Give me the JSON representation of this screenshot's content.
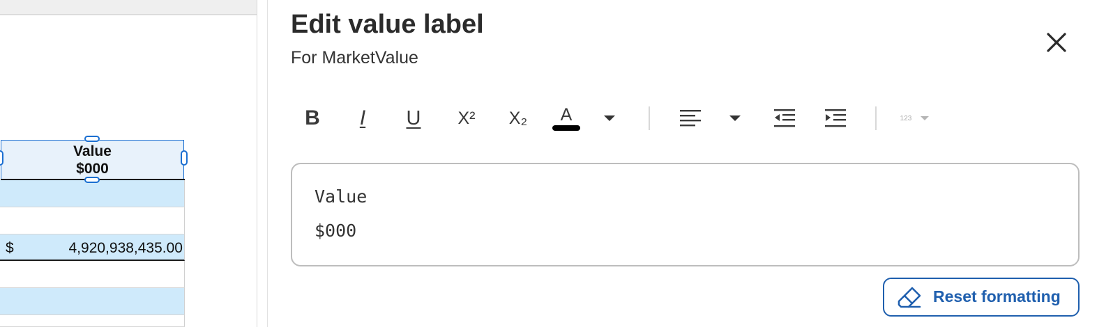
{
  "spreadsheet": {
    "header": {
      "line1": "Value",
      "line2": "$000"
    },
    "row_value": {
      "currency": "$",
      "amount": "4,920,938,435.00"
    }
  },
  "dialog": {
    "title": "Edit value label",
    "subtitle": "For MarketValue",
    "toolbar": {
      "bold": "B",
      "italic": "I",
      "underline": "U",
      "superscript": "X²",
      "subscript": "X₂",
      "text_color": "A",
      "text_color_swatch": "#000000",
      "number_format": "123"
    },
    "editor": {
      "line1": "Value",
      "line2": "$000"
    },
    "reset_button": "Reset formatting"
  },
  "colors": {
    "accent": "#1f5fae",
    "selection": "#1b6fd1",
    "row_highlight": "#cfeafb"
  }
}
